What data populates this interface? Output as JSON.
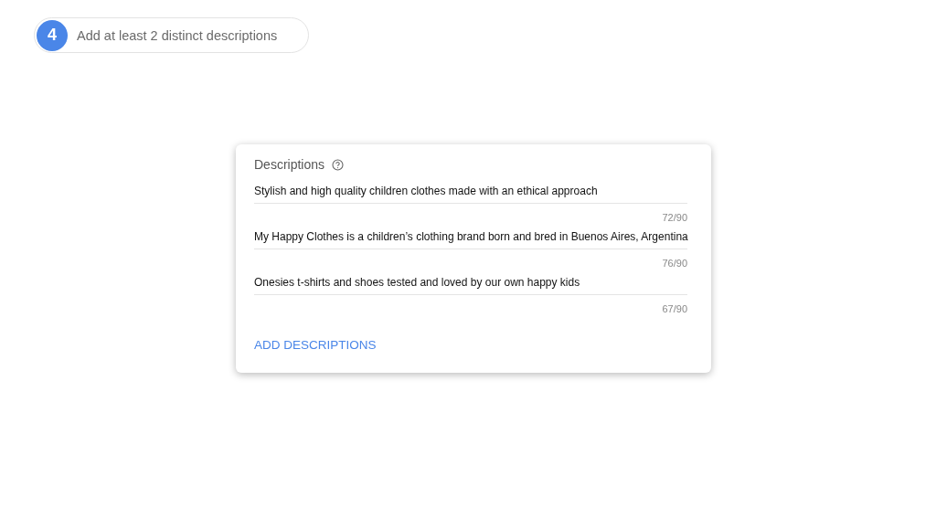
{
  "step": {
    "number": "4",
    "label": "Add at least 2 distinct descriptions"
  },
  "card": {
    "title": "Descriptions",
    "descriptions": [
      {
        "value": "Stylish and high quality children clothes made with an ethical approach",
        "count": "72/90"
      },
      {
        "value": "My Happy Clothes is a children’s clothing brand born and bred in Buenos Aires, Argentina",
        "count": "76/90"
      },
      {
        "value": "Onesies t-shirts and shoes tested and loved by our own happy kids",
        "count": "67/90"
      }
    ],
    "add_button": "ADD DESCRIPTIONS"
  }
}
